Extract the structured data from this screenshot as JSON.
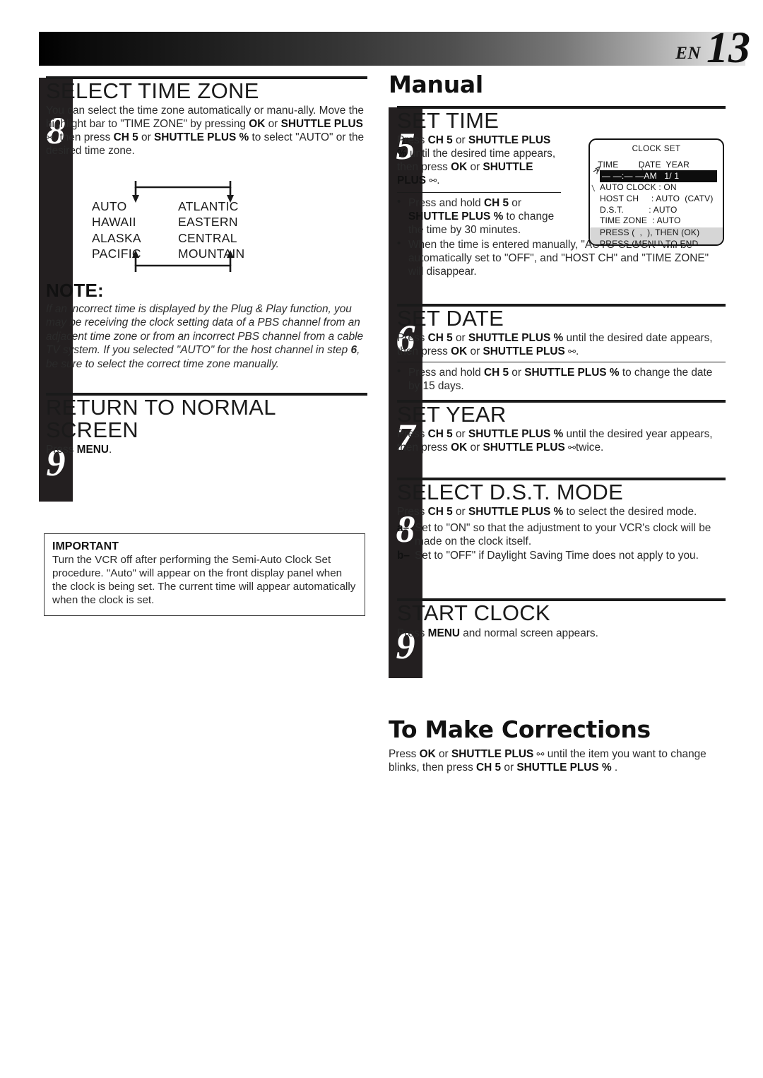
{
  "header": {
    "lang_code": "EN",
    "page_number": "13"
  },
  "left_column": {
    "steps": [
      {
        "number": "8",
        "title": "SELECT TIME ZONE",
        "body_html": "You can select the time zone automatically or manu-ally. Move the highlight bar to \"TIME ZONE\" by pressing <b>OK</b> or <b>SHUTTLE PLUS</b> <span class=\"glyph\">⚯</span>, then press <b>CH 5</b> or <b>SHUTTLE PLUS</b> <b>%</b> to select \"AUTO\" or the desired time zone."
      },
      {
        "number": "9",
        "title": "RETURN TO NORMAL SCREEN",
        "body_html": "Press <b>MENU</b>."
      }
    ],
    "timezone_diagram": {
      "column_a": [
        "AUTO",
        "HAWAII",
        "ALASKA",
        "PACIFIC"
      ],
      "column_b": [
        "ATLANTIC",
        "EASTERN",
        "CENTRAL",
        "MOUNTAIN"
      ]
    },
    "note": {
      "title": "NOTE:",
      "body_html": "If an incorrect time is displayed by the Plug &amp; Play function, you may be receiving the clock setting data of a PBS channel from an adjacent time zone or from an incorrect PBS channel from a cable TV system. If you selected \"AUTO\" for the host channel in step <b>6</b>, be sure to select the correct time zone manually."
    },
    "important": {
      "title": "IMPORTANT",
      "body": "Turn the VCR off after performing the Semi-Auto Clock Set procedure. \"Auto\" will appear on the front display panel when the clock is being set. The current time will appear automatically when the clock is set."
    }
  },
  "right_column": {
    "section_heading": "Manual",
    "steps": [
      {
        "number": "5",
        "title": "SET TIME",
        "body_html": "Press <b>CH 5</b> or <b>SHUTTLE PLUS</b> <b>%</b> until the desired time appears, then press <b>OK</b> or <b>SHUTTLE PLUS</b> <span class=\"glyph\">⚯</span>.",
        "bullets_html": [
          "Press and hold <b>CH 5</b> or <b>SHUTTLE PLUS</b> <b>%</b> to change the time by 30 minutes.",
          "When the time is entered manually, \"AUTO CLOCK\" will be automatically set to \"OFF\", and \"HOST CH\" and \"TIME ZONE\" will disappear."
        ]
      },
      {
        "number": "6",
        "title": "SET DATE",
        "body_html": "Press <b>CH 5</b> or <b>SHUTTLE PLUS</b> <b>%</b> until the desired date appears, then press <b>OK</b> or <b>SHUTTLE PLUS</b> <span class=\"glyph\">⚯</span>.",
        "bullets_html": [
          "Press and hold <b>CH 5</b> or <b>SHUTTLE PLUS</b> <b>%</b> to change the date by 15 days."
        ]
      },
      {
        "number": "7",
        "title": "SET YEAR",
        "body_html": "Press <b>CH 5</b> or <b>SHUTTLE PLUS</b> <b>%</b> until the desired year appears, then press <b>OK</b> or <b>SHUTTLE PLUS</b> <span class=\"glyph\">⚯</span>twice."
      },
      {
        "number": "8",
        "title": "SELECT D.S.T. MODE",
        "body_html": "Press <b>CH 5</b> or <b>SHUTTLE PLUS</b> <b>%</b> to select the desired mode.",
        "ab_items": [
          {
            "marker": "a–",
            "text_html": "Set to \"ON\" so that the adjustment to your VCR's clock will be made  on the clock itself."
          },
          {
            "marker": "b–",
            "text_html": "Set to \"OFF\" if Daylight Saving Time does not apply to you."
          }
        ]
      },
      {
        "number": "9",
        "title": "START CLOCK",
        "body_html": "Press <b>MENU</b> and normal screen appears."
      }
    ],
    "corrections": {
      "title": "To Make Corrections",
      "body_html": "Press <b>OK</b> or <b>SHUTTLE PLUS</b> <span class=\"glyph\">⚯</span> until the item you want to change blinks, then press <b>CH 5</b> or <b>SHUTTLE PLUS</b> <b>%</b> ."
    }
  },
  "osd_panel": {
    "title": "CLOCK SET",
    "header_row": "TIME        DATE  YEAR",
    "highlight_row": "— —:— —AM   1/ 1",
    "rows": [
      "AUTO CLOCK : ON",
      "HOST CH     : AUTO  (CATV)",
      "D.S.T.          : AUTO",
      "TIME ZONE  : AUTO"
    ],
    "footer_rows": [
      "PRESS (  ,  ), THEN (OK)",
      "PRESS (MENU) TO END"
    ]
  }
}
